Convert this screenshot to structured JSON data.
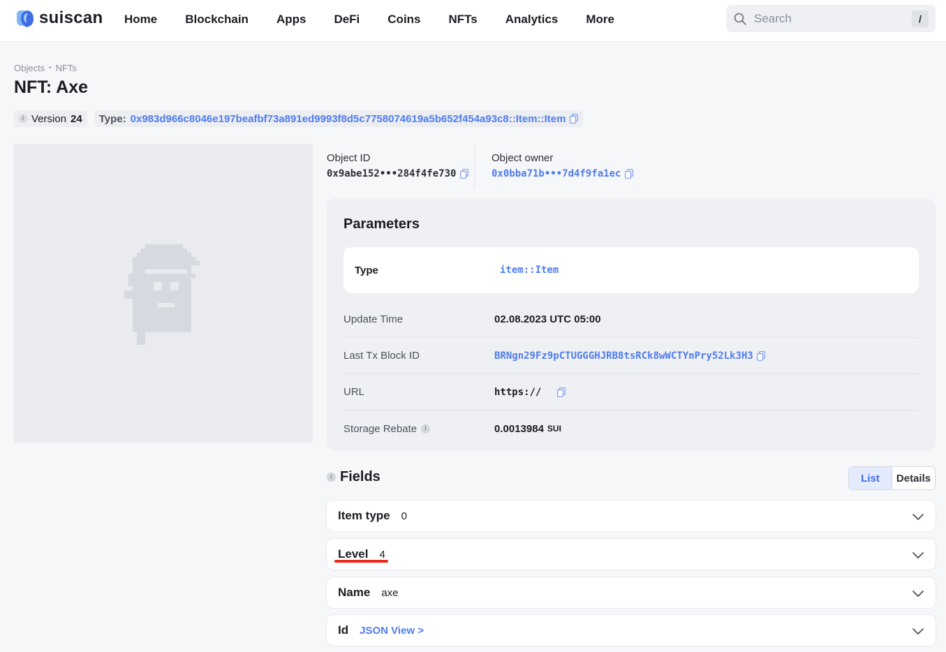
{
  "header": {
    "logo_text": "suiscan",
    "nav": [
      "Home",
      "Blockchain",
      "Apps",
      "DeFi",
      "Coins",
      "NFTs",
      "Analytics",
      "More"
    ],
    "search_placeholder": "Search",
    "search_shortcut": "/"
  },
  "breadcrumb": {
    "items": [
      "Objects",
      "NFTs"
    ]
  },
  "page_title": "NFT: Axe",
  "chips": {
    "version_label": "Version",
    "version_value": "24",
    "type_label": "Type:",
    "type_value": "0x983d966c8046e197beafbf73a891ed9993f8d5c7758074619a5b652f454a93c8::Item::Item"
  },
  "object": {
    "id_label": "Object ID",
    "id_value": "0x9abe152•••284f4fe730",
    "owner_label": "Object owner",
    "owner_value": "0x0bba71b•••7d4f9fa1ec"
  },
  "parameters": {
    "title": "Parameters",
    "type_key": "Type",
    "type_value": "item::Item",
    "rows": [
      {
        "key": "Update Time",
        "value": "02.08.2023 UTC 05:00"
      },
      {
        "key": "Last Tx Block ID",
        "value": "BRNgn29Fz9pCTUGGGHJRB8tsRCk8wWCTYnPry52Lk3H3"
      },
      {
        "key": "URL",
        "value": "https://"
      },
      {
        "key": "Storage Rebate",
        "value": "0.0013984",
        "unit": "SUI"
      }
    ]
  },
  "fields": {
    "title": "Fields",
    "view_options": [
      "List",
      "Details"
    ],
    "active_view": "List",
    "rows": [
      {
        "key": "Item type",
        "value": "0"
      },
      {
        "key": "Level",
        "value": "4"
      },
      {
        "key": "Name",
        "value": "axe"
      },
      {
        "key": "Id",
        "value": "JSON View >"
      }
    ]
  },
  "colors": {
    "accent": "#4f7cf0",
    "highlight_underline": "#e8291c"
  }
}
